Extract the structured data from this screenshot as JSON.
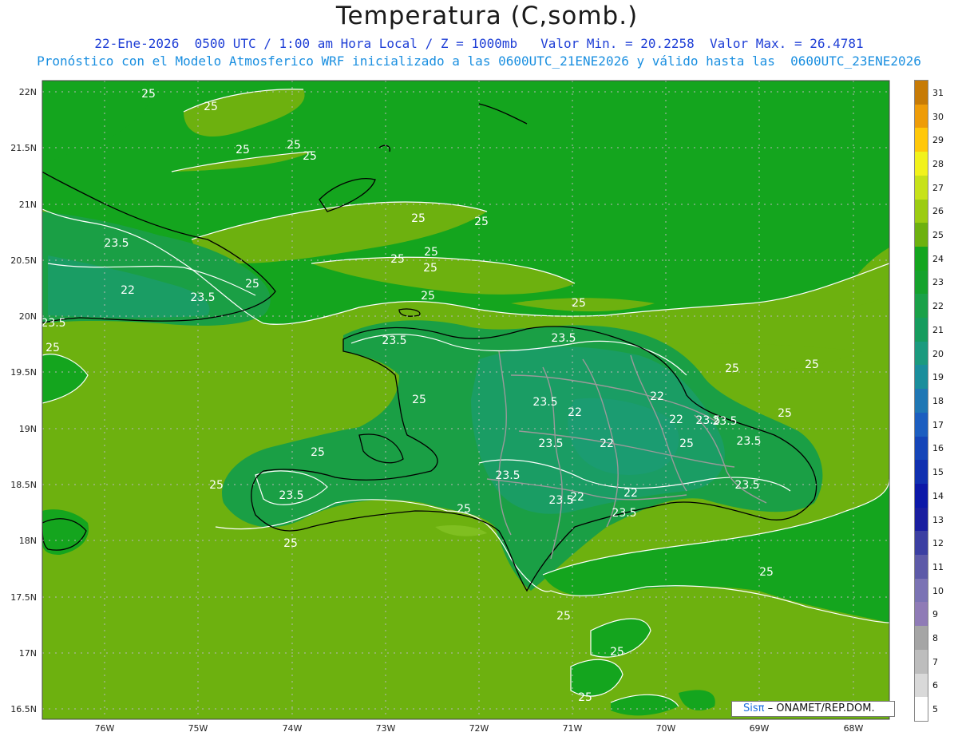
{
  "header": {
    "title": "Temperatura (C,somb.)",
    "subtitle_1": "22-Ene-2026  0500 UTC / 1:00 am Hora Local / Z = 1000mb   Valor Min. = 20.2258  Valor Max. = 26.4781",
    "subtitle_2": "Pronóstico con el Modelo Atmosferico WRF inicializado a las 0600UTC_21ENE2026 y válido hasta las  0600UTC_23ENE2026"
  },
  "axes": {
    "lat_labels": [
      "22N",
      "21.5N",
      "21N",
      "20.5N",
      "20N",
      "19.5N",
      "19N",
      "18.5N",
      "18N",
      "17.5N",
      "17N",
      "16.5N"
    ],
    "lon_labels": [
      "76W",
      "75W",
      "74W",
      "73W",
      "72W",
      "71W",
      "70W",
      "69W",
      "68W"
    ]
  },
  "colorbar": {
    "levels": [
      {
        "label": "5",
        "color": "#ffffff"
      },
      {
        "label": "6",
        "color": "#d9d9d9"
      },
      {
        "label": "7",
        "color": "#bdbdbd"
      },
      {
        "label": "8",
        "color": "#a5a5a5"
      },
      {
        "label": "9",
        "color": "#8f7bb6"
      },
      {
        "label": "10",
        "color": "#7b73b4"
      },
      {
        "label": "11",
        "color": "#5d5aa8"
      },
      {
        "label": "12",
        "color": "#3b3fa2"
      },
      {
        "label": "13",
        "color": "#1a1ea0"
      },
      {
        "label": "14",
        "color": "#0c18a8"
      },
      {
        "label": "15",
        "color": "#1030b0"
      },
      {
        "label": "16",
        "color": "#1545b8"
      },
      {
        "label": "17",
        "color": "#1c5ec0"
      },
      {
        "label": "18",
        "color": "#1f77b4"
      },
      {
        "label": "19",
        "color": "#1a8e9c"
      },
      {
        "label": "20",
        "color": "#1b9a7e"
      },
      {
        "label": "21",
        "color": "#169c5e"
      },
      {
        "label": "22",
        "color": "#1aa148"
      },
      {
        "label": "23",
        "color": "#15a22c"
      },
      {
        "label": "24",
        "color": "#14a51e"
      },
      {
        "label": "25",
        "color": "#6db10f"
      },
      {
        "label": "26",
        "color": "#9ccc12"
      },
      {
        "label": "27",
        "color": "#c7e21a"
      },
      {
        "label": "28",
        "color": "#f2f21c"
      },
      {
        "label": "29",
        "color": "#ffc80a"
      },
      {
        "label": "30",
        "color": "#ee9c08"
      },
      {
        "label": "31",
        "color": "#c77b06"
      }
    ]
  },
  "contour_labels": [
    {
      "text": "25"
    },
    {
      "text": "25"
    },
    {
      "text": "25"
    },
    {
      "text": "25"
    },
    {
      "text": "25"
    },
    {
      "text": "25"
    },
    {
      "text": "25"
    },
    {
      "text": "25"
    },
    {
      "text": "25"
    },
    {
      "text": "23.5"
    },
    {
      "text": "22"
    },
    {
      "text": "23.5"
    },
    {
      "text": "25"
    },
    {
      "text": "23.5"
    },
    {
      "text": "25"
    },
    {
      "text": "25"
    },
    {
      "text": "23.5"
    },
    {
      "text": "25"
    },
    {
      "text": "23.5"
    },
    {
      "text": "22"
    },
    {
      "text": "22"
    },
    {
      "text": "23.5"
    },
    {
      "text": "22"
    },
    {
      "text": "25"
    },
    {
      "text": "25"
    },
    {
      "text": "23.5"
    },
    {
      "text": "25"
    },
    {
      "text": "25"
    },
    {
      "text": "23.5"
    },
    {
      "text": "25"
    },
    {
      "text": "23.5"
    },
    {
      "text": "23.5"
    },
    {
      "text": "22"
    },
    {
      "text": "22"
    },
    {
      "text": "23.5"
    },
    {
      "text": "23.5"
    },
    {
      "text": "25"
    },
    {
      "text": "25"
    },
    {
      "text": "25"
    },
    {
      "text": "25"
    },
    {
      "text": "25"
    },
    {
      "text": "25"
    },
    {
      "text": "23.5"
    },
    {
      "text": "23.5"
    },
    {
      "text": "25"
    },
    {
      "text": "25"
    },
    {
      "text": "25"
    },
    {
      "text": "23.5"
    },
    {
      "text": "22"
    }
  ],
  "credit": {
    "brand": "Sisπ",
    "text": "– ONAMET/REP.DOM."
  },
  "colors": {
    "ocean_warm": "#6db10f",
    "ocean_cool": "#14a51e",
    "land": "#15a22c",
    "land_cool": "#1a9f45"
  }
}
